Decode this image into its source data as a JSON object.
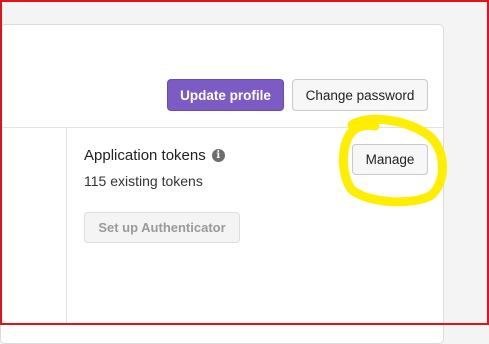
{
  "colors": {
    "primary": "#7c5cc4",
    "annotation": "#ffee00",
    "frame": "#e0131b"
  },
  "header": {
    "update_profile_label": "Update profile",
    "change_password_label": "Change password"
  },
  "tokens": {
    "title": "Application tokens",
    "info_icon": "info-icon",
    "count_text": "115 existing tokens",
    "manage_label": "Manage"
  },
  "authenticator": {
    "setup_label": "Set up Authenticator"
  }
}
